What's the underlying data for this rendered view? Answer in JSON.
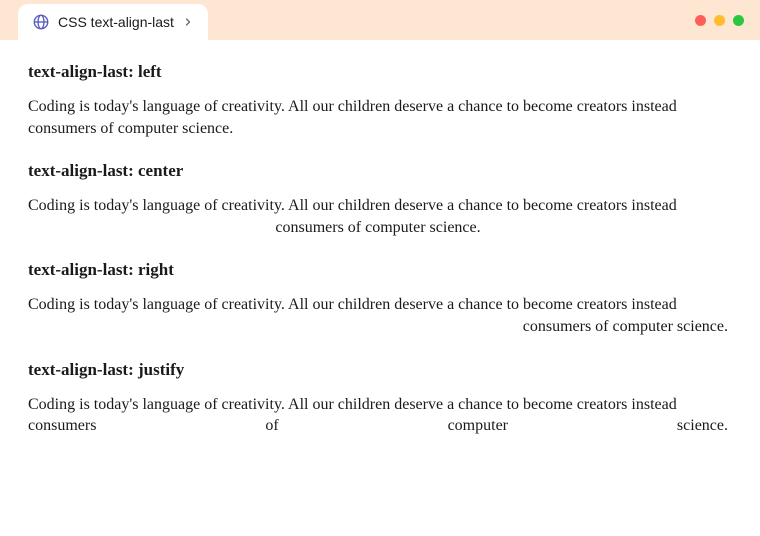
{
  "tab": {
    "title": "CSS text-align-last"
  },
  "sections": {
    "left": {
      "heading": "text-align-last: left",
      "text": "Coding is today's language of creativity. All our children deserve a chance to become creators instead consumers of computer science."
    },
    "center": {
      "heading": "text-align-last: center",
      "text": "Coding is today's language of creativity. All our children deserve a chance to become creators instead consumers of computer science."
    },
    "right": {
      "heading": "text-align-last: right",
      "text": "Coding is today's language of creativity. All our children deserve a chance to become creators instead consumers of computer science."
    },
    "justify": {
      "heading": "text-align-last: justify",
      "text": "Coding is today's language of creativity. All our children deserve a chance to become creators instead consumers of computer science."
    }
  }
}
